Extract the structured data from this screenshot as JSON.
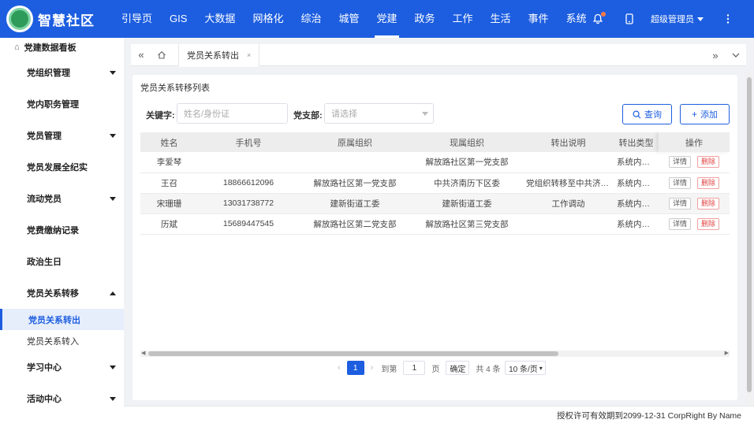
{
  "header": {
    "title": "智慧社区",
    "nav": [
      "引导页",
      "GIS",
      "大数据",
      "网格化",
      "综治",
      "城管",
      "党建",
      "政务",
      "工作",
      "生活",
      "事件",
      "系统"
    ],
    "active_nav": 6,
    "user": "超级管理员",
    "icons": [
      "bell-icon",
      "mobile-icon",
      "more-icon"
    ]
  },
  "sidebar": {
    "top": "党建数据看板",
    "items": [
      {
        "label": "党组织管理",
        "caret": "down"
      },
      {
        "label": "党内职务管理",
        "caret": "none"
      },
      {
        "label": "党员管理",
        "caret": "down"
      },
      {
        "label": "党员发展全纪实",
        "caret": "none"
      },
      {
        "label": "流动党员",
        "caret": "down"
      },
      {
        "label": "党费缴纳记录",
        "caret": "none"
      },
      {
        "label": "政治生日",
        "caret": "none"
      },
      {
        "label": "党员关系转移",
        "caret": "up"
      }
    ],
    "sub_items": [
      "党员关系转出",
      "党员关系转入"
    ],
    "bottom_items": [
      {
        "label": "学习中心",
        "caret": "down"
      },
      {
        "label": "活动中心",
        "caret": "down"
      }
    ]
  },
  "tabs": {
    "active": "党员关系转出"
  },
  "card": {
    "title": "党员关系转移列表",
    "keyword_label": "关键字:",
    "keyword_placeholder": "姓名/身份证",
    "branch_label": "党支部:",
    "branch_placeholder": "请选择",
    "search_button": "查询",
    "add_button": "添加"
  },
  "table": {
    "columns": [
      "姓名",
      "手机号",
      "原属组织",
      "现属组织",
      "转出说明",
      "转出类型",
      "操作"
    ],
    "rows": [
      [
        "李爱琴",
        "",
        "",
        "解放路社区第一党支部",
        "",
        "系统内转出"
      ],
      [
        "王召",
        "18866612096",
        "解放路社区第一党支部",
        "中共济南历下区委",
        "党组织转移至中共济南历下区委",
        "系统内转出"
      ],
      [
        "宋珊珊",
        "13031738772",
        "建新街道工委",
        "建新街道工委",
        "工作调动",
        "系统内转出"
      ],
      [
        "历斌",
        "15689447545",
        "解放路社区第二党支部",
        "解放路社区第三党支部",
        "",
        "系统内转出"
      ]
    ],
    "detail_label": "详情",
    "delete_label": "删除"
  },
  "pager": {
    "current": "1",
    "goto_label": "到第",
    "goto_value": "1",
    "page_label": "页",
    "confirm": "确定",
    "total": "共 4 条",
    "page_size": "10 条/页"
  },
  "footer": "授权许可有效期到2099-12-31 CorpRight By Name",
  "colors": {
    "primary": "#1d5ee0",
    "danger": "#e04545"
  }
}
